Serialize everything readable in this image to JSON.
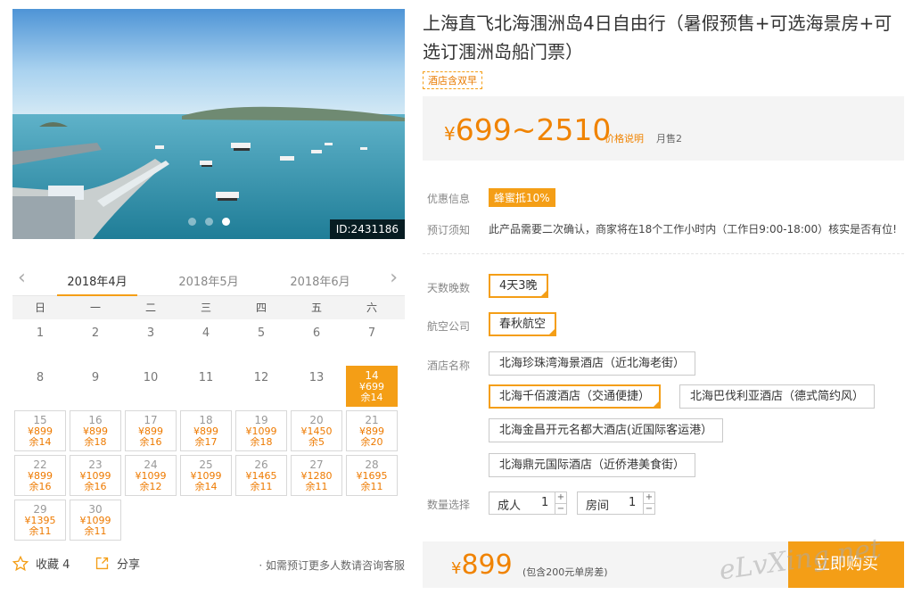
{
  "gallery": {
    "image_id": "ID:2431186",
    "dot_count": 3,
    "active_dot": 2
  },
  "calendar": {
    "months": [
      "2018年4月",
      "2018年5月",
      "2018年6月"
    ],
    "active_month": 0,
    "weekdays": [
      "日",
      "一",
      "二",
      "三",
      "四",
      "五",
      "六"
    ],
    "days": [
      {
        "d": "1"
      },
      {
        "d": "2"
      },
      {
        "d": "3"
      },
      {
        "d": "4"
      },
      {
        "d": "5"
      },
      {
        "d": "6"
      },
      {
        "d": "7"
      },
      {
        "d": "8"
      },
      {
        "d": "9"
      },
      {
        "d": "10"
      },
      {
        "d": "11"
      },
      {
        "d": "12"
      },
      {
        "d": "13"
      },
      {
        "d": "14",
        "p": "¥699",
        "r": "余14",
        "selected": true
      },
      {
        "d": "15",
        "p": "¥899",
        "r": "余14"
      },
      {
        "d": "16",
        "p": "¥899",
        "r": "余18"
      },
      {
        "d": "17",
        "p": "¥899",
        "r": "余16"
      },
      {
        "d": "18",
        "p": "¥899",
        "r": "余17"
      },
      {
        "d": "19",
        "p": "¥1099",
        "r": "余18"
      },
      {
        "d": "20",
        "p": "¥1450",
        "r": "余5"
      },
      {
        "d": "21",
        "p": "¥899",
        "r": "余20"
      },
      {
        "d": "22",
        "p": "¥899",
        "r": "余16"
      },
      {
        "d": "23",
        "p": "¥1099",
        "r": "余16"
      },
      {
        "d": "24",
        "p": "¥1099",
        "r": "余12"
      },
      {
        "d": "25",
        "p": "¥1099",
        "r": "余14"
      },
      {
        "d": "26",
        "p": "¥1465",
        "r": "余11"
      },
      {
        "d": "27",
        "p": "¥1280",
        "r": "余11"
      },
      {
        "d": "28",
        "p": "¥1695",
        "r": "余11"
      },
      {
        "d": "29",
        "p": "¥1395",
        "r": "余11"
      },
      {
        "d": "30",
        "p": "¥1099",
        "r": "余11"
      }
    ]
  },
  "actions": {
    "favorite_label": "收藏 4",
    "share_label": "分享",
    "note": "· 如需预订更多人数请咨询客服"
  },
  "product": {
    "title": "上海直飞北海涠洲岛4日自由行（暑假预售+可选海景房+可选订涠洲岛船门票）",
    "tag": "酒店含双早",
    "price_yen": "¥",
    "price_range": "699~2510",
    "price_link": "价格说明",
    "sold": "月售2"
  },
  "info": {
    "discount_label": "优惠信息",
    "discount_badge": "蜂蜜抵10%",
    "booking_label": "预订须知",
    "booking_text": "此产品需要二次确认，商家将在18个工作小时内（工作日9:00-18:00）核实是否有位!"
  },
  "options": {
    "duration_label": "天数晚数",
    "duration": "4天3晚",
    "airline_label": "航空公司",
    "airline": "春秋航空",
    "hotel_label": "酒店名称",
    "hotels": [
      "北海珍珠湾海景酒店（近北海老街）",
      "北海千佰渡酒店（交通便捷）",
      "北海巴伐利亚酒店（德式简约风）",
      "北海金昌开元名都大酒店(近国际客运港）",
      "北海鼎元国际酒店（近侨港美食街）"
    ],
    "selected_hotel": 1,
    "quantity_label": "数量选择",
    "adult_label": "成人",
    "adult_count": "1",
    "room_label": "房间",
    "room_count": "1",
    "plus": "+",
    "minus": "−"
  },
  "purchase": {
    "yen": "¥",
    "price": "899",
    "note": "(包含200元单房差)",
    "button": "立即购买"
  },
  "watermark": "eLvXing.net",
  "colors": {
    "accent": "#f49e16",
    "price": "#f08300",
    "panel": "#f4f4f4"
  }
}
